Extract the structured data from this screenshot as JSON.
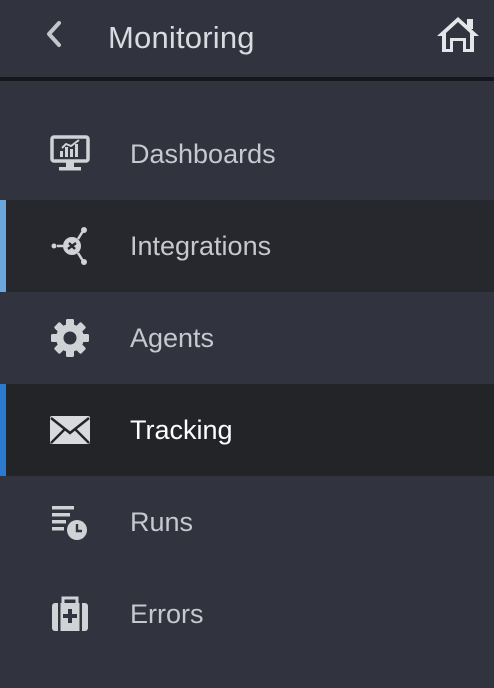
{
  "header": {
    "title": "Monitoring",
    "back_icon": "chevron-left-icon",
    "home_icon": "home-icon"
  },
  "nav": {
    "items": [
      {
        "label": "Dashboards",
        "icon": "monitor-chart-icon",
        "state": "default"
      },
      {
        "label": "Integrations",
        "icon": "integration-hub-icon",
        "state": "hovered"
      },
      {
        "label": "Agents",
        "icon": "gear-icon",
        "state": "default"
      },
      {
        "label": "Tracking",
        "icon": "envelope-icon",
        "state": "active"
      },
      {
        "label": "Runs",
        "icon": "list-clock-icon",
        "state": "default"
      },
      {
        "label": "Errors",
        "icon": "first-aid-kit-icon",
        "state": "default"
      }
    ]
  },
  "colors": {
    "background": "#31333f",
    "active_background": "#232427",
    "hover_background": "#27282e",
    "active_accent": "#2a7bd0",
    "hover_accent": "#6ba7dd",
    "text": "#c6c8ce",
    "active_text": "#ffffff",
    "icon": "#d0d2d6"
  }
}
